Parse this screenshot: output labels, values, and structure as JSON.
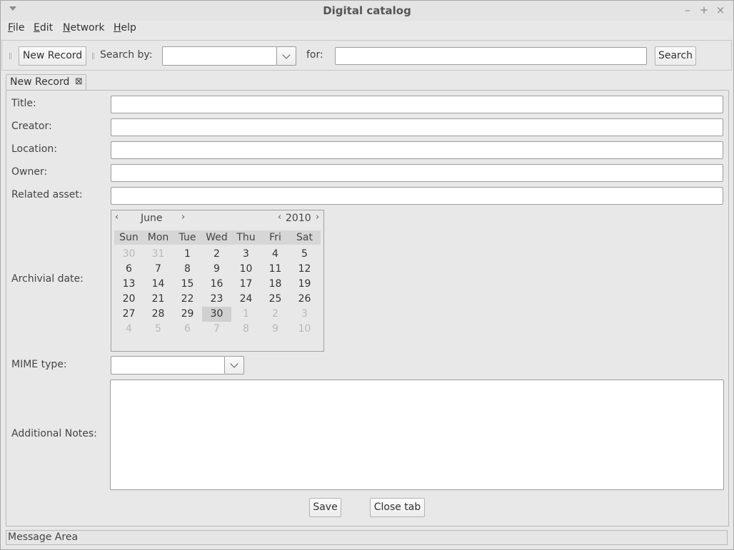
{
  "window": {
    "title": "Digital catalog"
  },
  "menubar": {
    "file": {
      "mnemonic": "F",
      "rest": "ile"
    },
    "edit": {
      "mnemonic": "E",
      "rest": "dit"
    },
    "network": {
      "mnemonic": "N",
      "rest": "etwork"
    },
    "help": {
      "mnemonic": "H",
      "rest": "elp"
    }
  },
  "toolbar": {
    "new_record": "New Record",
    "search_by": "Search by:",
    "search_by_value": "",
    "for": "for:",
    "query": "",
    "search": "Search"
  },
  "tab": {
    "label": "New Record"
  },
  "form": {
    "title_label": "Title:",
    "creator_label": "Creator:",
    "location_label": "Location:",
    "owner_label": "Owner:",
    "related_label": "Related asset:",
    "archival_label": "Archivial date:",
    "mime_label": "MIME type:",
    "notes_label": "Additional Notes:",
    "title_value": "",
    "creator_value": "",
    "location_value": "",
    "owner_value": "",
    "related_value": "",
    "mime_value": "",
    "notes_value": ""
  },
  "calendar": {
    "month": "June",
    "year": "2010",
    "day_names": [
      "Sun",
      "Mon",
      "Tue",
      "Wed",
      "Thu",
      "Fri",
      "Sat"
    ],
    "weeks": [
      [
        "30",
        "31",
        "1",
        "2",
        "3",
        "4",
        "5"
      ],
      [
        "6",
        "7",
        "8",
        "9",
        "10",
        "11",
        "12"
      ],
      [
        "13",
        "14",
        "15",
        "16",
        "17",
        "18",
        "19"
      ],
      [
        "20",
        "21",
        "22",
        "23",
        "24",
        "25",
        "26"
      ],
      [
        "27",
        "28",
        "29",
        "30",
        "1",
        "2",
        "3"
      ],
      [
        "4",
        "5",
        "6",
        "7",
        "8",
        "9",
        "10"
      ]
    ],
    "selected_day": "30"
  },
  "buttons": {
    "save": "Save",
    "close_tab": "Close tab"
  },
  "status": {
    "message": "Message Area"
  }
}
